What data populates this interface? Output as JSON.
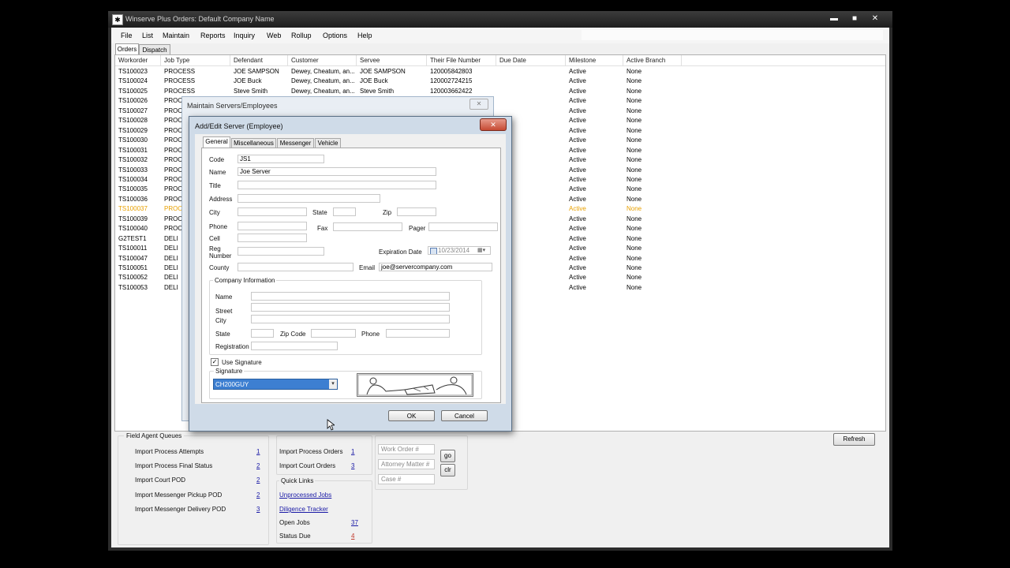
{
  "window": {
    "title": "Winserve Plus Orders: Default Company Name",
    "minimize": "▬",
    "maximize": "■",
    "close": "✕"
  },
  "menu": [
    "File",
    "List",
    "Maintain",
    "Reports",
    "Inquiry",
    "Web",
    "Rollup",
    "Options",
    "Help"
  ],
  "tabs": {
    "orders": "Orders",
    "dispatch": "Dispatch"
  },
  "columns": [
    "Workorder",
    "Job Type",
    "Defendant",
    "Customer",
    "Servee",
    "Their File Number",
    "Due Date",
    "Milestone",
    "Active Branch"
  ],
  "orders": [
    {
      "workorder": "TS100023",
      "job_type": "PROCESS",
      "defendant": "JOE SAMPSON",
      "customer": "Dewey, Cheatum, an...",
      "servee": "JOE SAMPSON",
      "file_number": "120005842803",
      "due_date": "",
      "milestone": "Active",
      "branch": "None"
    },
    {
      "workorder": "TS100024",
      "job_type": "PROCESS",
      "defendant": "JOE Buck",
      "customer": "Dewey, Cheatum, an...",
      "servee": "JOE Buck",
      "file_number": "120002724215",
      "due_date": "",
      "milestone": "Active",
      "branch": "None"
    },
    {
      "workorder": "TS100025",
      "job_type": "PROCESS",
      "defendant": "Steve Smith",
      "customer": "Dewey, Cheatum, an...",
      "servee": "Steve Smith",
      "file_number": "120003662422",
      "due_date": "",
      "milestone": "Active",
      "branch": "None"
    },
    {
      "workorder": "TS100026",
      "job_type": "PROC",
      "defendant": "",
      "customer": "",
      "servee": "",
      "file_number": "",
      "due_date": "",
      "milestone": "Active",
      "branch": "None"
    },
    {
      "workorder": "TS100027",
      "job_type": "PROC",
      "defendant": "",
      "customer": "",
      "servee": "",
      "file_number": "",
      "due_date": "",
      "milestone": "Active",
      "branch": "None"
    },
    {
      "workorder": "TS100028",
      "job_type": "PROC",
      "defendant": "",
      "customer": "",
      "servee": "",
      "file_number": "",
      "due_date": "",
      "milestone": "Active",
      "branch": "None"
    },
    {
      "workorder": "TS100029",
      "job_type": "PROC",
      "defendant": "",
      "customer": "",
      "servee": "",
      "file_number": "",
      "due_date": "",
      "milestone": "Active",
      "branch": "None"
    },
    {
      "workorder": "TS100030",
      "job_type": "PROC",
      "defendant": "",
      "customer": "",
      "servee": "",
      "file_number": "",
      "due_date": "",
      "milestone": "Active",
      "branch": "None"
    },
    {
      "workorder": "TS100031",
      "job_type": "PROC",
      "defendant": "",
      "customer": "",
      "servee": "",
      "file_number": "",
      "due_date": "",
      "milestone": "Active",
      "branch": "None"
    },
    {
      "workorder": "TS100032",
      "job_type": "PROC",
      "defendant": "",
      "customer": "",
      "servee": "",
      "file_number": "",
      "due_date": "",
      "milestone": "Active",
      "branch": "None"
    },
    {
      "workorder": "TS100033",
      "job_type": "PROC",
      "defendant": "",
      "customer": "",
      "servee": "",
      "file_number": "",
      "due_date": "",
      "milestone": "Active",
      "branch": "None"
    },
    {
      "workorder": "TS100034",
      "job_type": "PROC",
      "defendant": "",
      "customer": "",
      "servee": "",
      "file_number": "",
      "due_date": "",
      "milestone": "Active",
      "branch": "None"
    },
    {
      "workorder": "TS100035",
      "job_type": "PROC",
      "defendant": "",
      "customer": "",
      "servee": "",
      "file_number": "",
      "due_date": "",
      "milestone": "Active",
      "branch": "None"
    },
    {
      "workorder": "TS100036",
      "job_type": "PROC",
      "defendant": "",
      "customer": "",
      "servee": "",
      "file_number": "",
      "due_date": "",
      "milestone": "Active",
      "branch": "None"
    },
    {
      "workorder": "TS100037",
      "job_type": "PROC",
      "defendant": "",
      "customer": "",
      "servee": "",
      "file_number": "",
      "due_date": "",
      "milestone": "Active",
      "branch": "None",
      "highlight": true
    },
    {
      "workorder": "TS100039",
      "job_type": "PROC",
      "defendant": "",
      "customer": "",
      "servee": "",
      "file_number": "",
      "due_date": "",
      "milestone": "Active",
      "branch": "None"
    },
    {
      "workorder": "TS100040",
      "job_type": "PROC",
      "defendant": "",
      "customer": "",
      "servee": "",
      "file_number": "",
      "due_date": "",
      "milestone": "Active",
      "branch": "None"
    },
    {
      "workorder": "G2TEST1",
      "job_type": "DELI",
      "defendant": "",
      "customer": "",
      "servee": "",
      "file_number": "",
      "due_date": "",
      "milestone": "Active",
      "branch": "None"
    },
    {
      "workorder": "TS100011",
      "job_type": "DELI",
      "defendant": "",
      "customer": "",
      "servee": "",
      "file_number": "",
      "due_date": "",
      "milestone": "Active",
      "branch": "None"
    },
    {
      "workorder": "TS100047",
      "job_type": "DELI",
      "defendant": "",
      "customer": "",
      "servee": "",
      "file_number": "",
      "due_date": "",
      "milestone": "Active",
      "branch": "None"
    },
    {
      "workorder": "TS100051",
      "job_type": "DELI",
      "defendant": "",
      "customer": "",
      "servee": "",
      "file_number": "",
      "due_date": "",
      "milestone": "Active",
      "branch": "None"
    },
    {
      "workorder": "TS100052",
      "job_type": "DELI",
      "defendant": "",
      "customer": "",
      "servee": "",
      "file_number": "",
      "due_date": "",
      "milestone": "Active",
      "branch": "None"
    },
    {
      "workorder": "TS100053",
      "job_type": "DELI",
      "defendant": "",
      "customer": "",
      "servee": "",
      "file_number": "",
      "due_date": "",
      "milestone": "Active",
      "branch": "None"
    }
  ],
  "field_agent_queues": {
    "title": "Field Agent Queues",
    "items": [
      {
        "label": "Import Process Attempts",
        "count": "1"
      },
      {
        "label": "Import Process Final Status",
        "count": "2"
      },
      {
        "label": "Import Court POD",
        "count": "2"
      },
      {
        "label": "Import Messenger Pickup POD",
        "count": "2"
      },
      {
        "label": "Import Messenger Delivery POD",
        "count": "3"
      }
    ]
  },
  "import_queues": [
    {
      "label": "Import Process Orders",
      "count": "1"
    },
    {
      "label": "Import Court Orders",
      "count": "3"
    }
  ],
  "quick_links": {
    "title": "Quick Links",
    "links": [
      "Unprocessed Jobs",
      "Diligence Tracker"
    ],
    "counts": [
      {
        "label": "Open Jobs",
        "count": "37",
        "color": "#1a1aa6"
      },
      {
        "label": "Status Due",
        "count": "4",
        "color": "#c0392b"
      }
    ]
  },
  "search": {
    "work_order_placeholder": "Work Order #",
    "attorney_placeholder": "Attorney Matter #",
    "case_placeholder": "Case #",
    "go_label": "go",
    "clear_label": "clr"
  },
  "refresh_label": "Refresh",
  "bg_dialog": {
    "title": "Maintain Servers/Employees",
    "close": "✕"
  },
  "dialog": {
    "title": "Add/Edit Server (Employee)",
    "close": "✕",
    "tabs": [
      "General",
      "Miscellaneous",
      "Messenger",
      "Vehicle"
    ],
    "labels": {
      "code": "Code",
      "name": "Name",
      "title": "Title",
      "address": "Address",
      "city": "City",
      "state": "State",
      "zip": "Zip",
      "phone": "Phone",
      "fax": "Fax",
      "pager": "Pager",
      "cell": "Cell",
      "reg_number": "Reg Number",
      "expiration": "Expiration Date",
      "county": "County",
      "email": "Email"
    },
    "values": {
      "code": "JS1",
      "name": "Joe Server",
      "expiration": "10/23/2014",
      "email": "joe@servercompany.com"
    },
    "company": {
      "title": "Company Information",
      "labels": {
        "name": "Name",
        "street": "Street",
        "city": "City",
        "state": "State",
        "zip": "Zip Code",
        "phone": "Phone",
        "registration": "Registration"
      }
    },
    "use_signature": "Use Signature",
    "signature_label": "Signature",
    "signature_value": "CH200GUY",
    "ok": "OK",
    "cancel": "Cancel"
  }
}
